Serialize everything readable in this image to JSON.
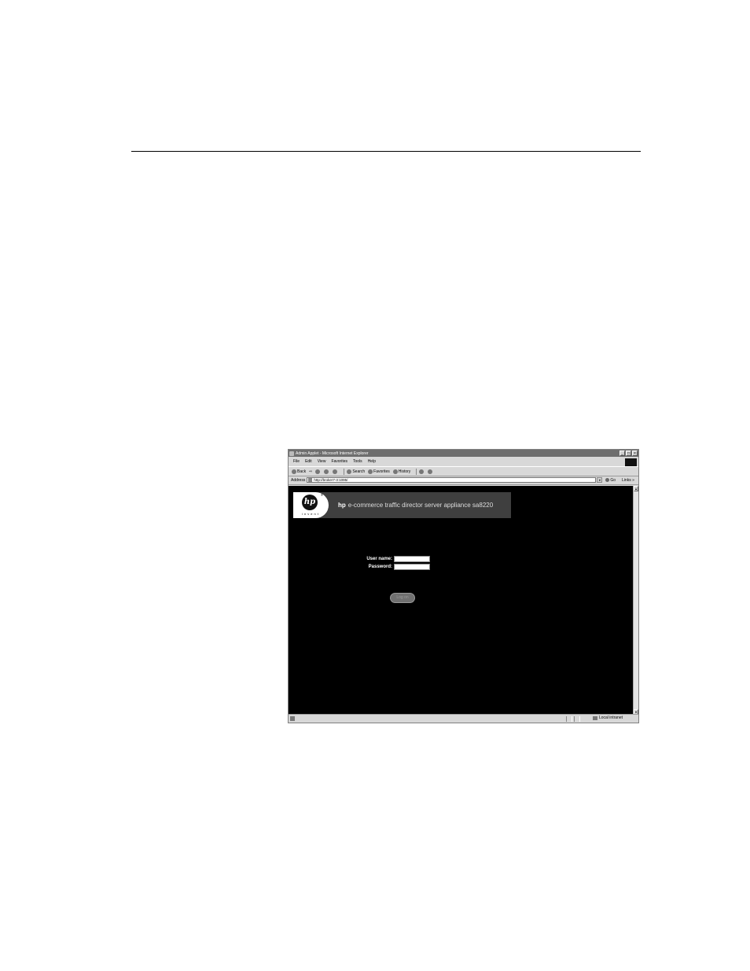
{
  "window": {
    "title": "Admin Applet - Microsoft Internet Explorer",
    "controls": {
      "minimize": "_",
      "maximize": "□",
      "close": "×"
    }
  },
  "menu": [
    "File",
    "Edit",
    "View",
    "Favorites",
    "Tools",
    "Help"
  ],
  "toolbar": {
    "back": "Back",
    "forward": "⇨",
    "search": "Search",
    "favorites": "Favorites",
    "history": "History"
  },
  "address": {
    "label": "Address",
    "url": "http://broker7-3:1095/",
    "go": "Go",
    "links": "Links »"
  },
  "banner": {
    "logo_text": "hp",
    "logo_tagline": "invent",
    "brand": "hp",
    "product": "e-commerce traffic director server appliance sa8220"
  },
  "login": {
    "username_label": "User name:",
    "password_label": "Password:",
    "username_value": "",
    "password_value": "",
    "button_label": "Log on"
  },
  "status": {
    "zone": "Local intranet"
  },
  "icons": {
    "ie": "ie-icon",
    "page": "page-icon",
    "zone": "intranet-icon"
  }
}
